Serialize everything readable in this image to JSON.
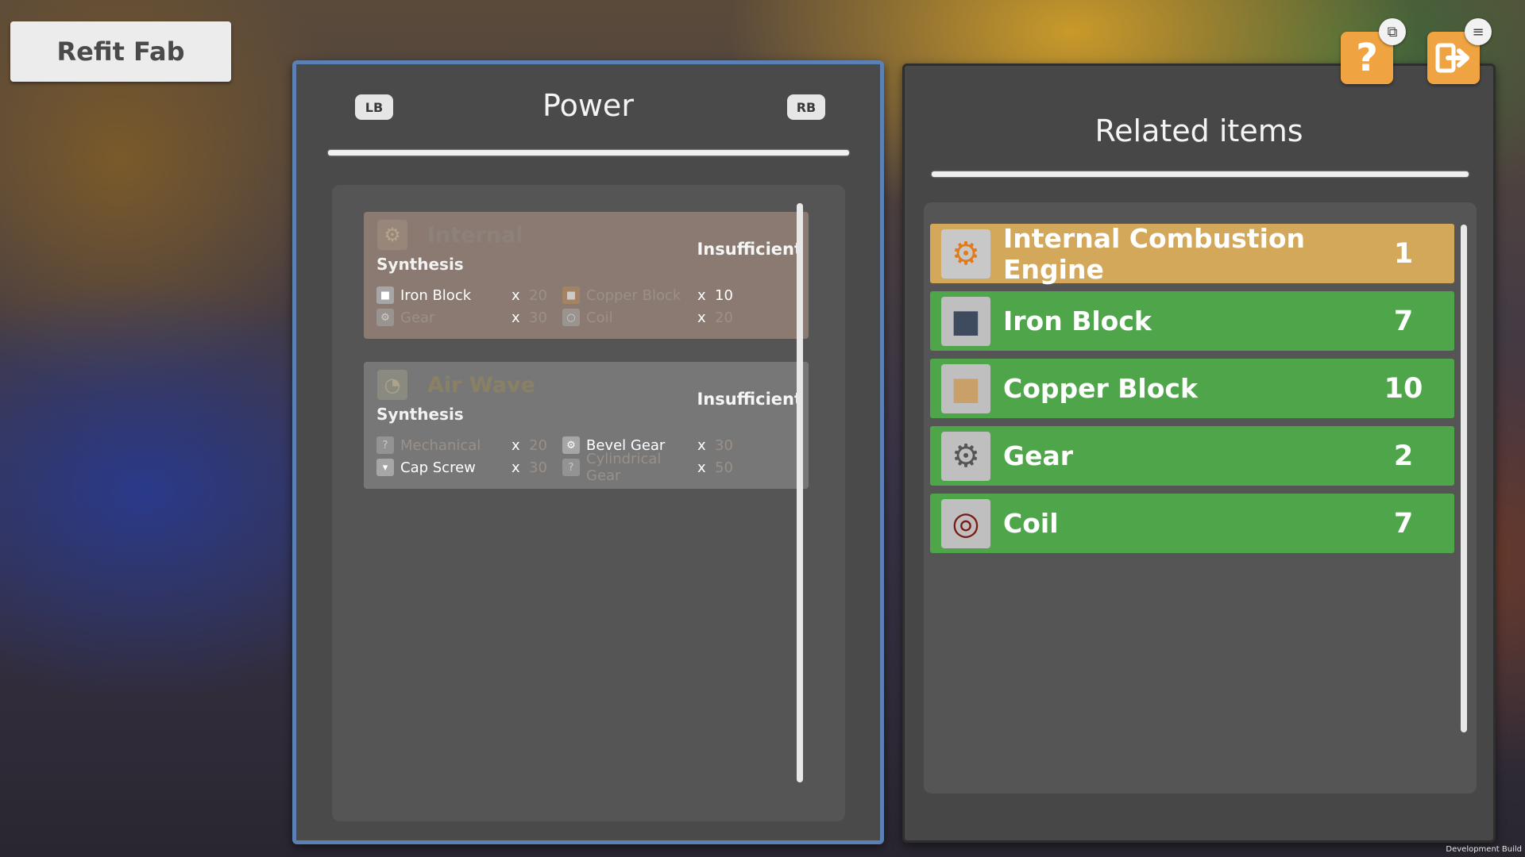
{
  "header": {
    "title": "Refit Fab"
  },
  "left_panel": {
    "lb_label": "LB",
    "rb_label": "RB",
    "title": "Power",
    "recipes": [
      {
        "name": "Internal",
        "type": "Synthesis",
        "status": "Insufficient",
        "icon": "engine-icon",
        "ingredients": [
          {
            "name": "Iron Block",
            "x": "x",
            "qty": "20",
            "icon": "iron-block-icon"
          },
          {
            "name": "Copper Block",
            "x": "x",
            "qty": "10",
            "icon": "copper-block-icon"
          },
          {
            "name": "Gear",
            "x": "x",
            "qty": "30",
            "icon": "gear-icon"
          },
          {
            "name": "Coil",
            "x": "x",
            "qty": "20",
            "icon": "coil-icon"
          }
        ]
      },
      {
        "name": "Air Wave",
        "type": "Synthesis",
        "status": "Insufficient",
        "icon": "gauge-icon",
        "ingredients": [
          {
            "name": "Mechanical",
            "x": "x",
            "qty": "20",
            "icon": "unknown-icon"
          },
          {
            "name": "Bevel Gear",
            "x": "x",
            "qty": "30",
            "icon": "bevel-gear-icon"
          },
          {
            "name": "Cap Screw",
            "x": "x",
            "qty": "30",
            "icon": "screw-icon"
          },
          {
            "name": "Cylindrical Gear",
            "x": "x",
            "qty": "50",
            "icon": "unknown-icon"
          }
        ]
      }
    ]
  },
  "right_panel": {
    "title": "Related items",
    "items": [
      {
        "name": "Internal Combustion Engine",
        "count": "1",
        "icon": "engine-icon"
      },
      {
        "name": "Iron Block",
        "count": "7",
        "icon": "iron-block-icon"
      },
      {
        "name": "Copper Block",
        "count": "10",
        "icon": "copper-block-icon"
      },
      {
        "name": "Gear",
        "count": "2",
        "icon": "gear-icon"
      },
      {
        "name": "Coil",
        "count": "7",
        "icon": "coil-icon"
      }
    ]
  },
  "controls": {
    "help_icon": "question-icon",
    "exit_icon": "exit-icon",
    "badge_a_icon": "window-icon",
    "badge_b_icon": "menu-icon"
  },
  "footer": {
    "build_label": "Development Build"
  },
  "colors": {
    "selected_row": "#d3a85a",
    "available_row": "#4fa64a",
    "panel_border": "#5b80b4",
    "button_orange": "#f0a441"
  }
}
